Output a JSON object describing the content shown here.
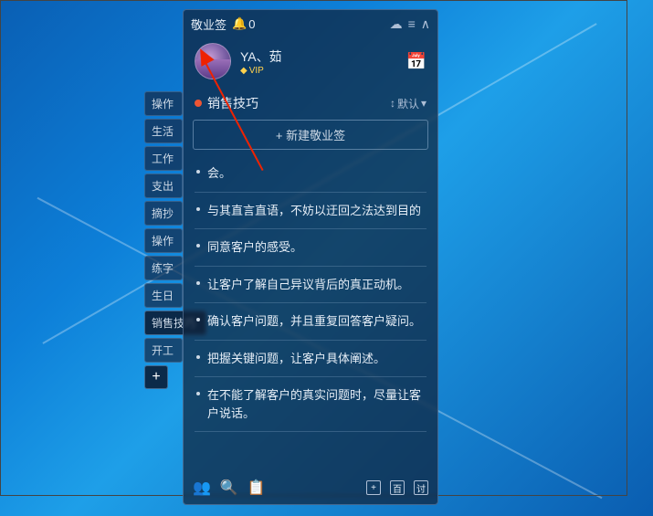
{
  "app": {
    "name": "敬业签",
    "bell_count": "0"
  },
  "user": {
    "name": "YA、茹",
    "vip_label": "VIP"
  },
  "section": {
    "title": "销售技巧",
    "sort_label": "默认",
    "sort_icon": "↕"
  },
  "new_button": "+ 新建敬业签",
  "sidebar_tabs": [
    "操作",
    "生活",
    "工作",
    "支出",
    "摘抄",
    "操作",
    "练字",
    "生日",
    "销售技巧",
    "开工"
  ],
  "add_label": "+",
  "notes": [
    "会。",
    "与其直言直语，不妨以迂回之法达到目的",
    "同意客户的感受。",
    "让客户了解自己异议背后的真正动机。",
    "确认客户问题，并且重复回答客户疑问。",
    "把握关键问题，让客户具体阐述。",
    "在不能了解客户的真实问题时，尽量让客户说话。"
  ],
  "bottom_icons": {
    "plus": "+",
    "hundred": "百",
    "discuss": "讨"
  }
}
